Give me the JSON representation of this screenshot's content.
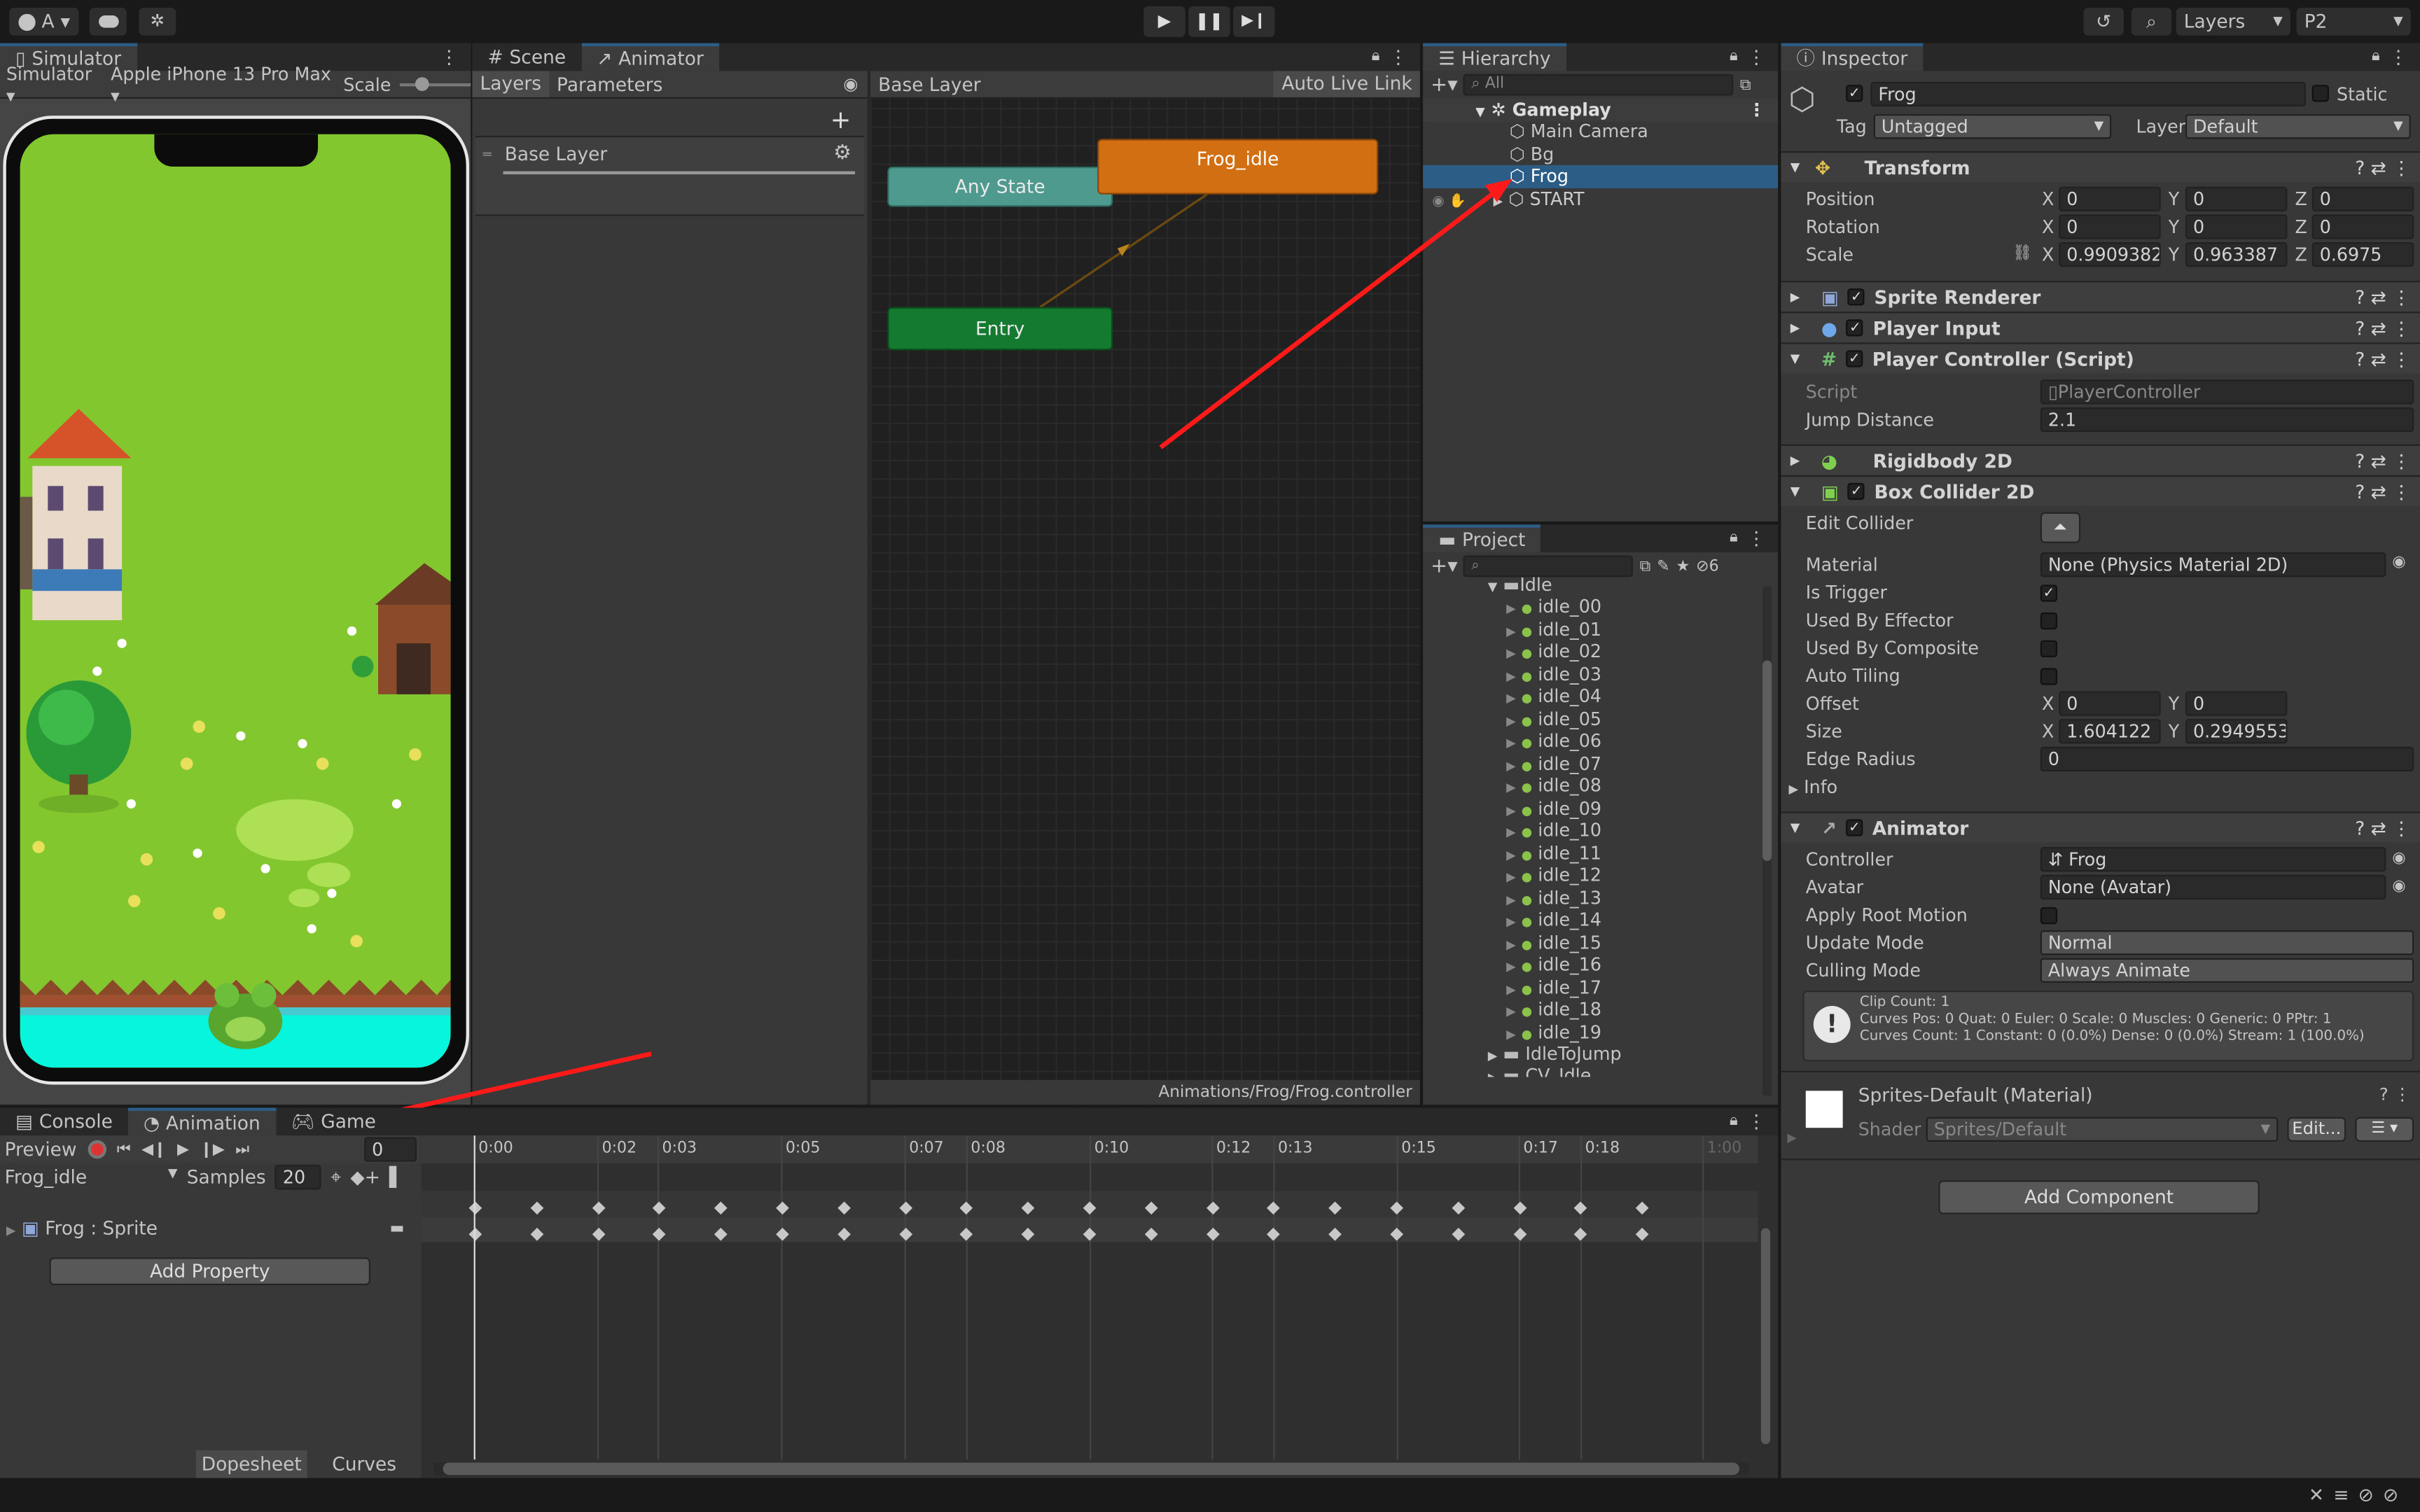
{
  "toolbar": {
    "account": "A",
    "layers": "Layers",
    "layout": "P2"
  },
  "simulator": {
    "tab": "Simulator",
    "mode": "Simulator",
    "device": "Apple iPhone 13 Pro Max",
    "scale_label": "Scale"
  },
  "animator": {
    "tab_scene": "Scene",
    "tab_animator": "Animator",
    "tab_layers": "Layers",
    "tab_parameters": "Parameters",
    "breadcrumb": "Base Layer",
    "auto_live_link": "Auto Live Link",
    "layer_name": "Base Layer",
    "states": {
      "any_state": "Any State",
      "frog_idle": "Frog_idle",
      "entry": "Entry"
    },
    "footer_path": "Animations/Frog/Frog.controller"
  },
  "hierarchy": {
    "tab": "Hierarchy",
    "search_placeholder": "All",
    "scene": "Gameplay",
    "items": [
      "Main Camera",
      "Bg",
      "Frog",
      "START"
    ]
  },
  "project": {
    "tab": "Project",
    "hidden_count": "6",
    "folder": "Idle",
    "files": [
      "idle_00",
      "idle_01",
      "idle_02",
      "idle_03",
      "idle_04",
      "idle_05",
      "idle_06",
      "idle_07",
      "idle_08",
      "idle_09",
      "idle_10",
      "idle_11",
      "idle_12",
      "idle_13",
      "idle_14",
      "idle_15",
      "idle_16",
      "idle_17",
      "idle_18",
      "idle_19"
    ],
    "next_folder": "IdleToJump",
    "cut_folder": "CV_Idle"
  },
  "inspector": {
    "tab": "Inspector",
    "name": "Frog",
    "static": "Static",
    "tag_label": "Tag",
    "tag": "Untagged",
    "layer_label": "Layer",
    "layer": "Default",
    "transform": {
      "title": "Transform",
      "position": "Position",
      "rotation": "Rotation",
      "scale": "Scale",
      "pos": [
        "0",
        "0",
        "0"
      ],
      "rot": [
        "0",
        "0",
        "0"
      ],
      "scl": [
        "0.9909382",
        "0.963387",
        "0.6975"
      ]
    },
    "sprite_renderer": "Sprite Renderer",
    "player_input": "Player Input",
    "player_controller": {
      "title": "Player Controller (Script)",
      "script_label": "Script",
      "script": "PlayerController",
      "jump_label": "Jump Distance",
      "jump": "2.1"
    },
    "rigidbody": "Rigidbody 2D",
    "box_collider": {
      "title": "Box Collider 2D",
      "edit": "Edit Collider",
      "material_label": "Material",
      "material": "None (Physics Material 2D)",
      "is_trigger": "Is Trigger",
      "used_effector": "Used By Effector",
      "used_composite": "Used By Composite",
      "auto_tiling": "Auto Tiling",
      "offset": "Offset",
      "offset_vals": [
        "0",
        "0"
      ],
      "size": "Size",
      "size_vals": [
        "1.604122",
        "0.2949553"
      ],
      "edge": "Edge Radius",
      "edge_val": "0",
      "info": "Info"
    },
    "animator": {
      "title": "Animator",
      "controller_label": "Controller",
      "controller": "Frog",
      "avatar_label": "Avatar",
      "avatar": "None (Avatar)",
      "root_motion": "Apply Root Motion",
      "update_label": "Update Mode",
      "update": "Normal",
      "culling_label": "Culling Mode",
      "culling": "Always Animate",
      "info1": "Clip Count: 1",
      "info2": "Curves Pos: 0 Quat: 0 Euler: 0 Scale: 0 Muscles: 0 Generic: 0 PPtr: 1",
      "info3": "Curves Count: 1 Constant: 0 (0.0%) Dense: 0 (0.0%) Stream: 1 (100.0%)"
    },
    "material": {
      "title": "Sprites-Default (Material)",
      "shader_label": "Shader",
      "shader": "Sprites/Default",
      "edit": "Edit..."
    },
    "add_component": "Add Component"
  },
  "animation": {
    "tab_console": "Console",
    "tab_animation": "Animation",
    "tab_game": "Game",
    "preview": "Preview",
    "frame": "0",
    "clip": "Frog_idle",
    "samples_label": "Samples",
    "samples": "20",
    "property": "Frog : Sprite",
    "add_property": "Add Property",
    "dopesheet": "Dopesheet",
    "curves": "Curves",
    "ticks": [
      "0:00",
      "0:02",
      "0:03",
      "0:05",
      "0:07",
      "0:08",
      "0:10",
      "0:12",
      "0:13",
      "0:15",
      "0:17",
      "0:18",
      "1:00"
    ]
  }
}
